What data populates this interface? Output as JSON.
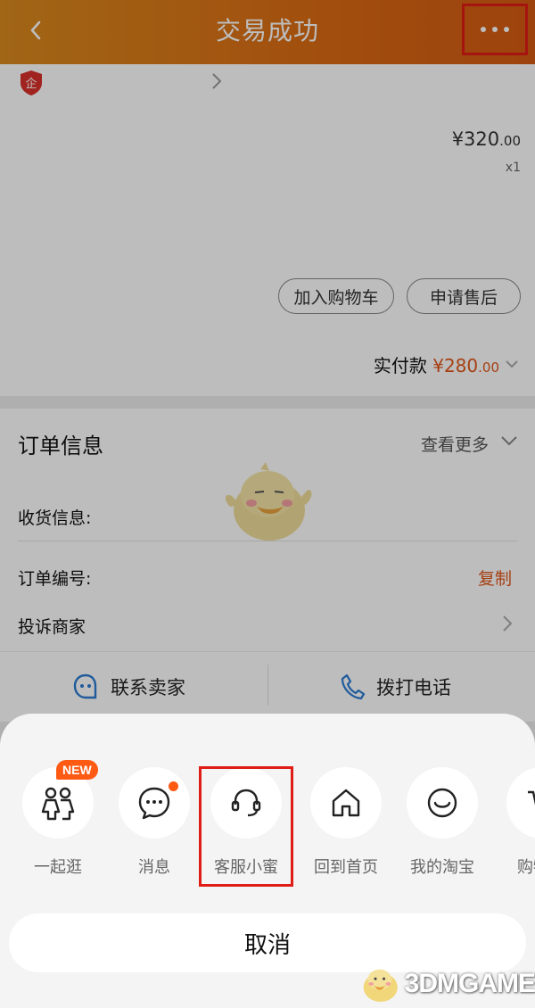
{
  "header": {
    "title": "交易成功"
  },
  "product": {
    "price_main": "¥320",
    "price_cents": ".00",
    "quantity": "x1"
  },
  "actions": {
    "add_to_cart": "加入购物车",
    "after_sale": "申请售后"
  },
  "payment": {
    "label": "实付款",
    "amount_main": "¥280",
    "amount_cents": ".00"
  },
  "order_info": {
    "title": "订单信息",
    "view_more": "查看更多",
    "shipping_label": "收货信息:",
    "order_number_label": "订单编号:",
    "copy_label": "复制",
    "complain_label": "投诉商家"
  },
  "contact": {
    "seller": "联系卖家",
    "call": "拨打电话"
  },
  "share_menu": {
    "items": [
      {
        "label": "一起逛",
        "icon": "people-icon",
        "badge": "NEW"
      },
      {
        "label": "消息",
        "icon": "message-icon"
      },
      {
        "label": "客服小蜜",
        "icon": "headset-icon"
      },
      {
        "label": "回到首页",
        "icon": "home-icon"
      },
      {
        "label": "我的淘宝",
        "icon": "smile-icon"
      },
      {
        "label": "购物",
        "icon": "cart-icon"
      }
    ],
    "cancel": "取消"
  },
  "watermark": {
    "text": "3DMGAME"
  },
  "colors": {
    "accent": "#db6d14",
    "price": "#e1571a",
    "highlight": "#e01c16"
  }
}
